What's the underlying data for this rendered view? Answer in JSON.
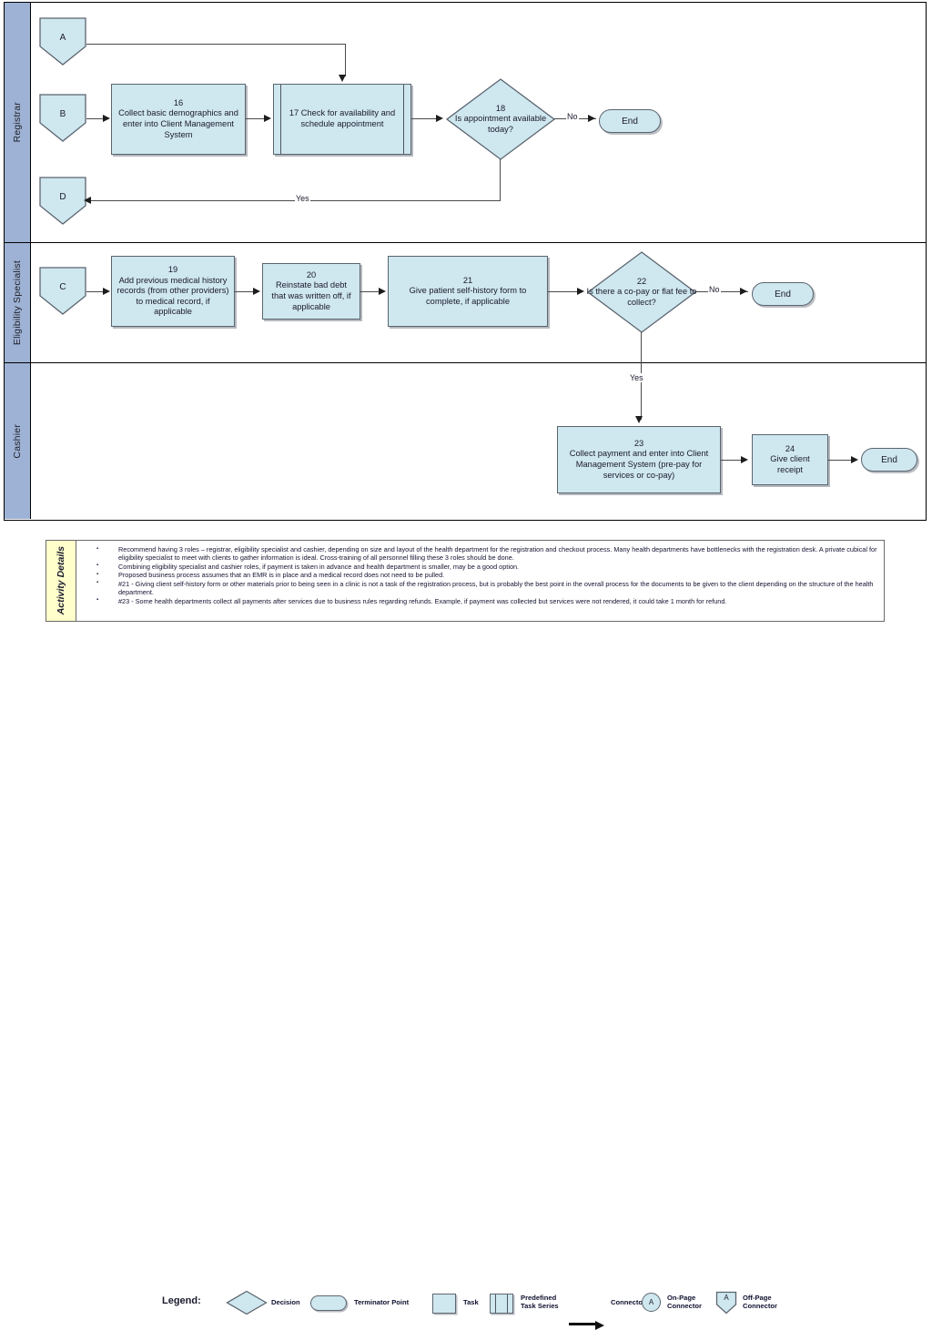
{
  "pool": {
    "lanes": [
      {
        "id": "registrar",
        "label": "Registrar"
      },
      {
        "id": "eligibility",
        "label": "Eligibility Specialist"
      },
      {
        "id": "cashier",
        "label": "Cashier"
      }
    ]
  },
  "nodes": {
    "connector_a": {
      "label": "A",
      "type": "off-page-connector"
    },
    "connector_b": {
      "label": "B",
      "type": "off-page-connector"
    },
    "connector_c": {
      "label": "C",
      "type": "off-page-connector"
    },
    "connector_d": {
      "label": "D",
      "type": "off-page-connector"
    },
    "task16": {
      "number": "16",
      "text": "Collect basic demographics and enter into Client Management System"
    },
    "task17": {
      "number": "17",
      "text": "Check for availability and schedule appointment"
    },
    "decision18": {
      "number": "18",
      "text": "Is appointment available today?"
    },
    "end1": {
      "label": "End"
    },
    "task19": {
      "number": "19",
      "text": "Add previous medical history records (from other providers) to medical record, if applicable"
    },
    "task20": {
      "number": "20",
      "text": "Reinstate bad debt that was written off, if applicable"
    },
    "task21": {
      "number": "21",
      "text": "Give patient self-history form to complete, if applicable"
    },
    "decision22": {
      "number": "22",
      "text": "Is there a co-pay or flat fee to collect?"
    },
    "end2": {
      "label": "End"
    },
    "task23": {
      "number": "23",
      "text": "Collect payment and enter into Client Management System (pre-pay for services or co-pay)"
    },
    "task24": {
      "number": "24",
      "text": "Give client receipt"
    },
    "end3": {
      "label": "End"
    }
  },
  "edge_labels": {
    "d18_no": "No",
    "d18_yes": "Yes",
    "d22_no": "No",
    "d22_yes": "Yes"
  },
  "activity_details": {
    "title": "Activity Details",
    "bullets": [
      "Recommend having 3 roles – registrar, eligibility specialist and cashier, depending on size and layout of the health department for the registration and checkout process.  Many health departments have bottlenecks with the registration desk.  A private cubical for eligibility specialist to meet with clients to gather information is ideal. Cross-training of all personnel filling these 3 roles should be done.",
      "Combining eligibility specialist and cashier roles, if payment is taken in advance and health department is smaller, may be a good option.",
      "Proposed business process assumes that an EMR is in place and a medical record does not need to be pulled.",
      "#21 - Giving client self-history form or other materials prior to being seen in a clinic is not a task of the registration process, but is probably the best point in the overall process for the documents to be given to the client depending on the structure of the health department.",
      "#23 - Some health departments collect all payments after services due to business rules regarding refunds. Example, if payment was collected but services were not rendered, it could take 1 month for refund."
    ]
  },
  "legend": {
    "title": "Legend:",
    "items": [
      {
        "icon": "decision-diamond-icon",
        "label": "Decision"
      },
      {
        "icon": "terminator-icon",
        "label": "Terminator Point"
      },
      {
        "icon": "task-box-icon",
        "label": "Task"
      },
      {
        "icon": "predefined-task-icon",
        "label": "Predefined\nTask Series"
      },
      {
        "icon": "arrow-connector-icon",
        "label": "Connector"
      },
      {
        "icon": "on-page-connector-icon",
        "label": "On-Page\nConnector",
        "glyph": "A"
      },
      {
        "icon": "off-page-connector-icon",
        "label": "Off-Page\nConnector",
        "glyph": "A"
      }
    ]
  },
  "colors": {
    "shape_fill": "#cfe7ee",
    "shape_stroke": "#5a6470",
    "lane_header": "#9db2d4",
    "details_tab": "#ffffcc",
    "connector": "#4a4a4a"
  }
}
